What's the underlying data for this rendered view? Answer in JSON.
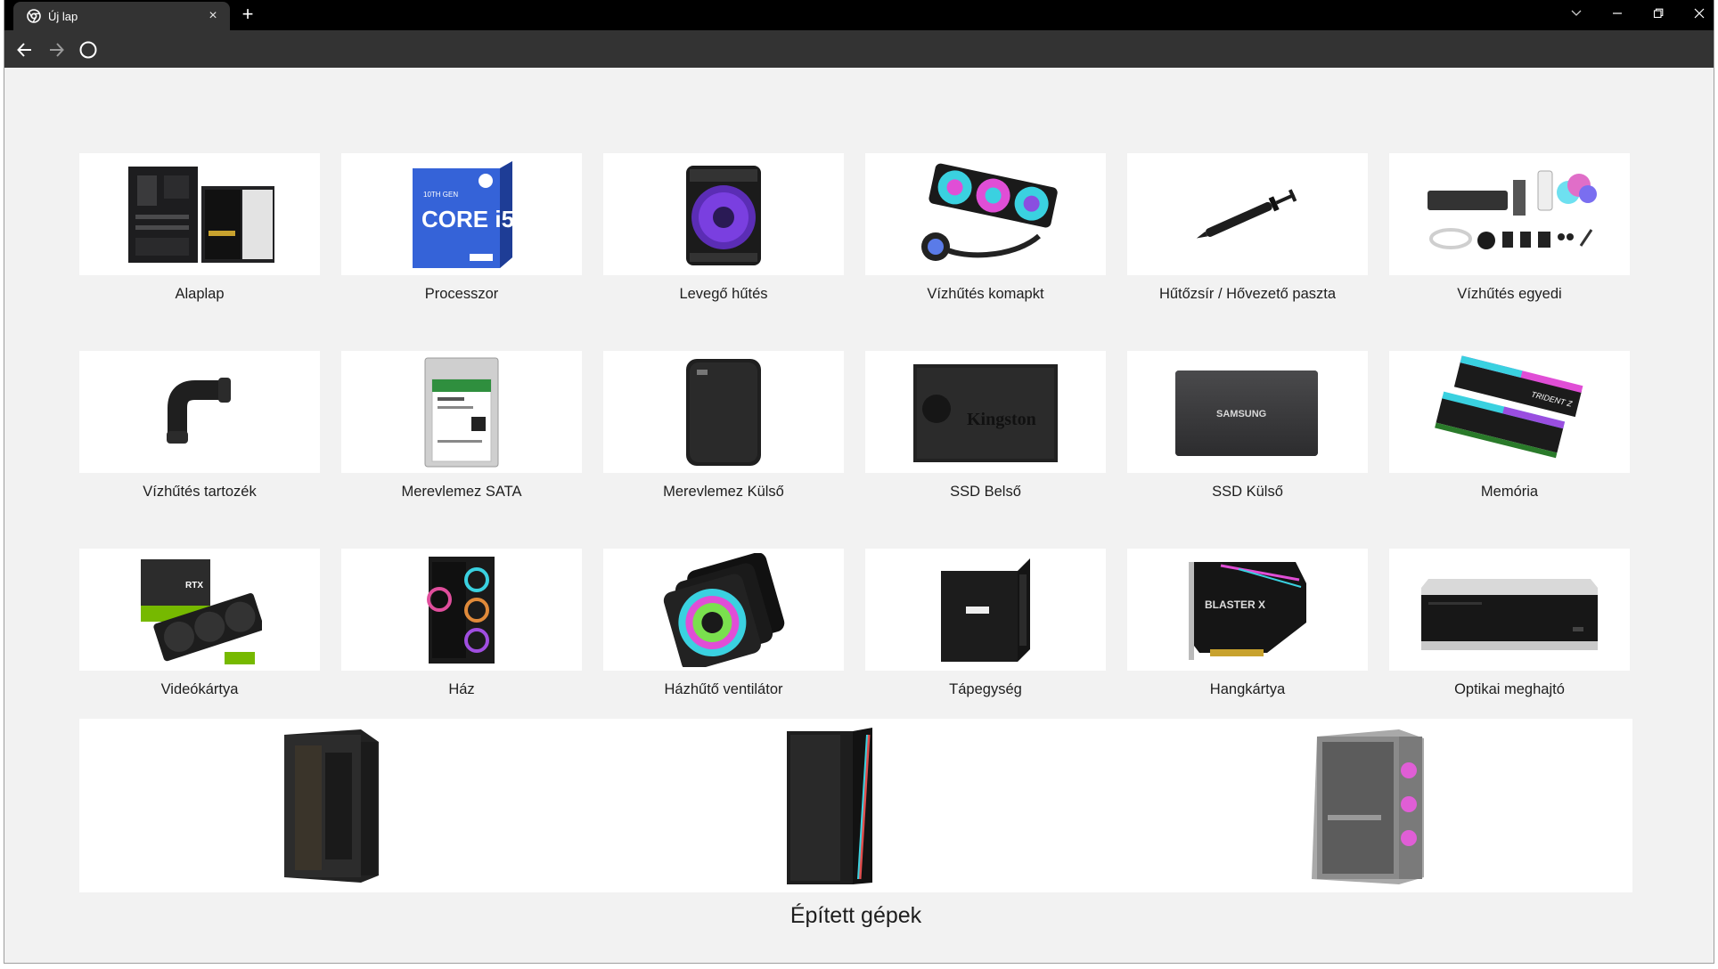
{
  "browser": {
    "tab_title": "Új lap",
    "tab_close": "×",
    "new_tab": "+"
  },
  "categories": [
    {
      "label": "Alaplap",
      "icon": "motherboard-icon"
    },
    {
      "label": "Processzor",
      "icon": "cpu-box-icon"
    },
    {
      "label": "Levegő hűtés",
      "icon": "air-cooler-icon"
    },
    {
      "label": "Vízhűtés komapkt",
      "icon": "aio-cooler-icon"
    },
    {
      "label": "Hűtőzsír / Hővezető paszta",
      "icon": "thermal-paste-icon"
    },
    {
      "label": "Vízhűtés egyedi",
      "icon": "custom-loop-icon"
    },
    {
      "label": "Vízhűtés tartozék",
      "icon": "fitting-icon"
    },
    {
      "label": "Merevlemez SATA",
      "icon": "hdd-icon"
    },
    {
      "label": "Merevlemez Külső",
      "icon": "external-hdd-icon"
    },
    {
      "label": "SSD Belső",
      "icon": "ssd-icon"
    },
    {
      "label": "SSD Külső",
      "icon": "external-ssd-icon"
    },
    {
      "label": "Memória",
      "icon": "ram-icon"
    },
    {
      "label": "Videókártya",
      "icon": "gpu-icon"
    },
    {
      "label": "Ház",
      "icon": "case-icon"
    },
    {
      "label": "Házhűtő ventilátor",
      "icon": "fan-icon"
    },
    {
      "label": "Tápegység",
      "icon": "psu-icon"
    },
    {
      "label": "Hangkártya",
      "icon": "sound-card-icon"
    },
    {
      "label": "Optikai meghajtó",
      "icon": "optical-drive-icon"
    }
  ],
  "product_texts": {
    "cpu_brand": "CORE i5",
    "cpu_gen": "10TH GEN",
    "ssd_brand": "Kingston",
    "ext_ssd_brand": "SAMSUNG",
    "ram_brand": "TRIDENT Z",
    "gpu_brand": "RTX",
    "sound_brand": "BLASTER X"
  },
  "built": {
    "label": "Épített gépek"
  }
}
